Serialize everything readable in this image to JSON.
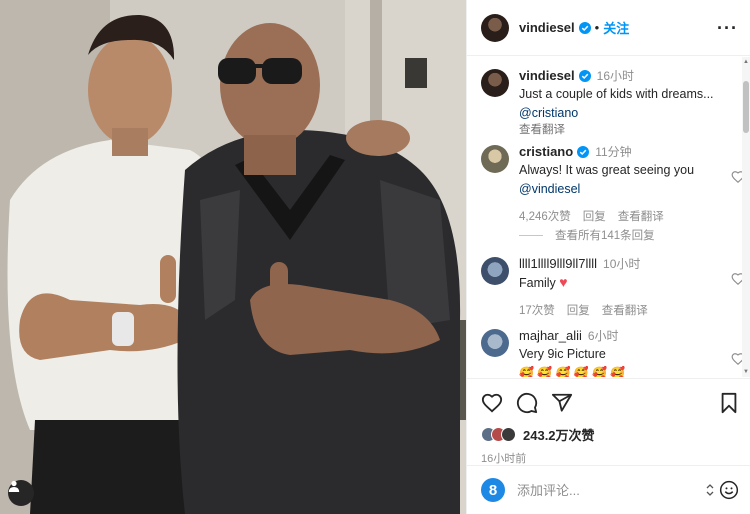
{
  "post": {
    "author": "vindiesel",
    "follow_label": "关注",
    "more_label": "···",
    "photo_alt": ""
  },
  "caption": {
    "username": "vindiesel",
    "time": "16小时",
    "text": "Just a couple of kids with dreams...",
    "mention": "@cristiano",
    "translate": "查看翻译"
  },
  "comments": [
    {
      "username": "cristiano",
      "verified": true,
      "time": "11分钟",
      "text": "Always! It was great seeing you",
      "mention": "@vindiesel",
      "likes": "4,246次赞",
      "reply": "回复",
      "translate": "查看翻译",
      "view_replies": "查看所有141条回复"
    },
    {
      "username": "llll1llll9lll9ll7llll",
      "verified": false,
      "time": "10小时",
      "text": "Family",
      "emoji": "♥",
      "likes": "17次赞",
      "reply": "回复",
      "translate": "查看翻译"
    },
    {
      "username": "majhar_alii",
      "verified": false,
      "time": "6小时",
      "text": "Very 9ic Picture",
      "emoji": "🥰 🥰 🥰 🥰 🥰 🥰"
    }
  ],
  "footer": {
    "likes": "243.2万次赞",
    "time": "16小时前",
    "comment_placeholder": "添加评论...",
    "emoji_icon_label": "8"
  },
  "icons": {
    "like": "heart-icon",
    "comment": "comment-icon",
    "share": "share-icon",
    "save": "bookmark-icon",
    "verified": "verified-badge-icon",
    "user_tag": "user-tag-icon"
  },
  "colors": {
    "link": "#00376b",
    "follow": "#0095f6",
    "muted": "#8e8e8e",
    "heart": "#ed4956"
  }
}
